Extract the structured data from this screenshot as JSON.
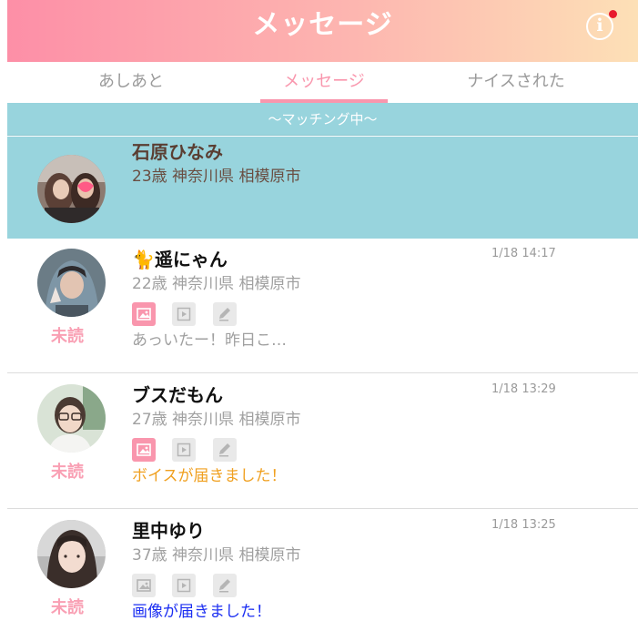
{
  "header": {
    "title": "メッセージ",
    "info_icon": "info-icon",
    "notification_color": "#e8192c"
  },
  "tabs": [
    {
      "label": "あしあと",
      "active": false
    },
    {
      "label": "メッセージ",
      "active": true
    },
    {
      "label": "ナイスされた",
      "active": false
    }
  ],
  "matching": {
    "label": "〜マッチング中〜",
    "user": {
      "name": "石原ひなみ",
      "detail": "23歳 神奈川県 相模原市"
    }
  },
  "messages": [
    {
      "name": "🐈遥にゃん",
      "detail": "22歳 神奈川県 相模原市",
      "time": "1/18 14:17",
      "status": "未読",
      "preview": "あっいたー！昨日こ…",
      "preview_color": "#a0a0a0",
      "icons": [
        "image-icon",
        "video-icon",
        "pen-icon"
      ],
      "active_icon": "image-icon"
    },
    {
      "name": "ブスだもん",
      "detail": "27歳 神奈川県 相模原市",
      "time": "1/18 13:29",
      "status": "未読",
      "preview": "ボイスが届きました！",
      "preview_color": "#f0a020",
      "icons": [
        "image-icon",
        "video-icon",
        "pen-icon"
      ],
      "active_icon": "image-icon"
    },
    {
      "name": "里中ゆり",
      "detail": "37歳 神奈川県 相模原市",
      "time": "1/18 13:25",
      "status": "未読",
      "preview": "画像が届きました！",
      "preview_color": "#1b2ef2",
      "icons": [
        "image-icon",
        "video-icon",
        "pen-icon"
      ],
      "active_icon": null
    }
  ],
  "colors": {
    "accent_pink": "#f996ad",
    "matching_bg": "#98d4dd"
  }
}
